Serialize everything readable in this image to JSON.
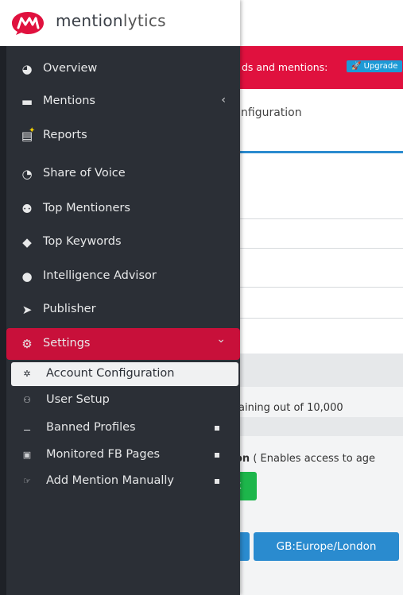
{
  "brand": {
    "name_part1": "mention",
    "name_part2": "lytics"
  },
  "alert": {
    "text": "ds and mentions:",
    "upgrade_label": "Upgrade"
  },
  "tab": {
    "label": "nfiguration"
  },
  "account": {
    "remaining_text": "aining out of 10,000"
  },
  "feature": {
    "title": "on",
    "description": " ( Enables access to age"
  },
  "buttons": {
    "green_label": "k",
    "timezone_label": "GB:Europe/London"
  },
  "sidebar": {
    "items": [
      {
        "label": "Overview",
        "icon": "dashboard-icon"
      },
      {
        "label": "Mentions",
        "icon": "comment-icon",
        "chevron": "‹"
      },
      {
        "label": "Reports",
        "icon": "report-icon"
      },
      {
        "label": "Share of Voice",
        "icon": "pie-chart-icon"
      },
      {
        "label": "Top Mentioners",
        "icon": "users-icon"
      },
      {
        "label": "Top Keywords",
        "icon": "tags-icon"
      },
      {
        "label": "Intelligence Advisor",
        "icon": "brain-icon"
      },
      {
        "label": "Publisher",
        "icon": "send-icon"
      },
      {
        "label": "Settings",
        "icon": "cogs-icon",
        "chevron": "⌄"
      }
    ],
    "settings_sub": [
      {
        "label": "Account Configuration",
        "icon": "cog-icon"
      },
      {
        "label": "User Setup",
        "icon": "users-small-icon"
      },
      {
        "label": "Banned Profiles",
        "icon": "user-ban-icon"
      },
      {
        "label": "Monitored FB Pages",
        "icon": "facebook-icon"
      },
      {
        "label": "Add Mention Manually",
        "icon": "hand-pointer-icon"
      }
    ]
  },
  "colors": {
    "accent": "#c8103a",
    "sidebar_bg": "#2b2f36",
    "primary_blue": "#2a8bcf",
    "success_green": "#1db64b"
  }
}
